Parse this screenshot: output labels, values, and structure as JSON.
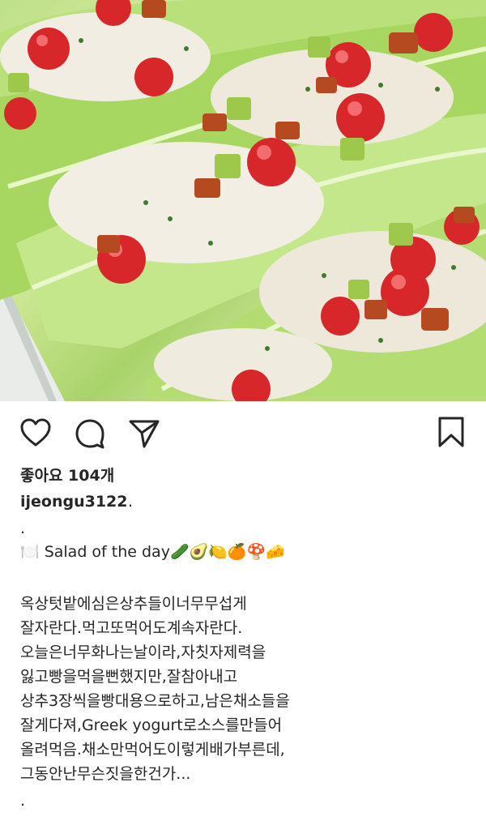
{
  "post": {
    "likes_label": "좋아요 104개",
    "username": "ijeongu3122",
    "username_suffix": ".",
    "caption_lines": [
      ".",
      "🍽️ Salad of the day🥒🥑🍋🍊🍄🧀",
      "",
      "옥상텃밭에심은상추들이너무무섭게",
      "잘자란다.먹고또먹어도계속자란다.",
      "오늘은너무화나는날이라,자칫자제력을",
      "잃고빵을먹을뻔했지만,잘참아내고",
      "상추3장씩을빵대용으로하고,남은채소들을",
      "잘게다져,Greek yogurt로소스를만들어",
      "올려먹음.채소만먹어도이렇게배가부른데,",
      "그동안난무슨짓을한건가...",
      "."
    ]
  },
  "icons": {
    "like": "heart-icon",
    "comment": "comment-icon",
    "share": "send-icon",
    "save": "bookmark-icon"
  }
}
